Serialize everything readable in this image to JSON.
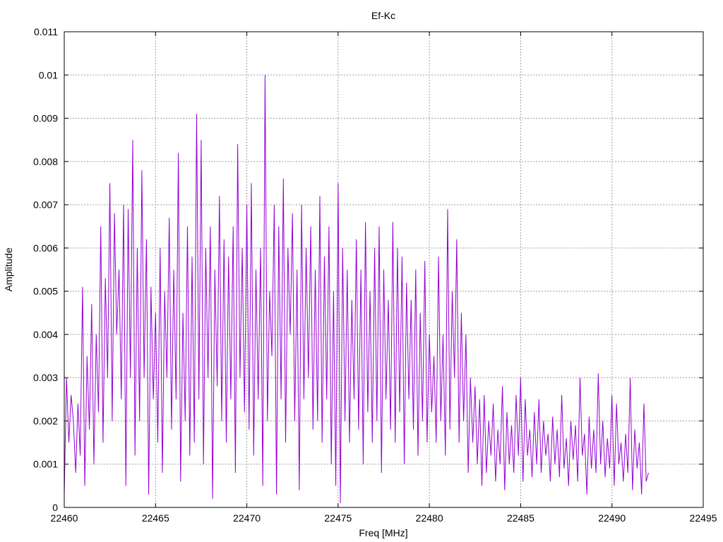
{
  "chart_data": {
    "type": "line",
    "title": "Ef-Kc",
    "xlabel": "Freq [MHz]",
    "ylabel": "Amplitude",
    "xlim": [
      22460,
      22495
    ],
    "ylim": [
      0,
      0.011
    ],
    "grid": true,
    "series_color": "#9400d3",
    "xticks": [
      "22460",
      "22465",
      "22470",
      "22475",
      "22480",
      "22485",
      "22490",
      "22495"
    ],
    "yticks": [
      "0",
      "0.001",
      "0.002",
      "0.003",
      "0.004",
      "0.005",
      "0.006",
      "0.007",
      "0.008",
      "0.009",
      "0.01",
      "0.011"
    ],
    "x_start": 22460,
    "x_step": 0.125,
    "values": [
      0.0003,
      0.003,
      0.0015,
      0.0026,
      0.002,
      0.0008,
      0.0024,
      0.0012,
      0.0051,
      0.0005,
      0.0035,
      0.0018,
      0.0047,
      0.001,
      0.004,
      0.0022,
      0.0065,
      0.0015,
      0.0053,
      0.003,
      0.0075,
      0.002,
      0.0068,
      0.004,
      0.0055,
      0.0025,
      0.007,
      0.0005,
      0.0069,
      0.003,
      0.0085,
      0.0012,
      0.006,
      0.002,
      0.0078,
      0.003,
      0.0062,
      0.0003,
      0.0051,
      0.0025,
      0.0045,
      0.0015,
      0.006,
      0.0008,
      0.005,
      0.003,
      0.0067,
      0.0018,
      0.0055,
      0.0025,
      0.0082,
      0.0006,
      0.0045,
      0.002,
      0.0065,
      0.0012,
      0.0058,
      0.0015,
      0.0091,
      0.0025,
      0.0085,
      0.001,
      0.006,
      0.003,
      0.0065,
      0.0002,
      0.0055,
      0.0028,
      0.0072,
      0.002,
      0.0062,
      0.0015,
      0.0058,
      0.0025,
      0.0065,
      0.0008,
      0.0084,
      0.003,
      0.006,
      0.0022,
      0.007,
      0.0018,
      0.0075,
      0.0012,
      0.0055,
      0.0025,
      0.006,
      0.0005,
      0.01,
      0.002,
      0.005,
      0.0035,
      0.007,
      0.0003,
      0.0065,
      0.0025,
      0.0076,
      0.0015,
      0.006,
      0.004,
      0.0068,
      0.002,
      0.0055,
      0.0004,
      0.007,
      0.0025,
      0.006,
      0.003,
      0.0065,
      0.0018,
      0.0055,
      0.002,
      0.0072,
      0.0015,
      0.0058,
      0.0025,
      0.0065,
      0.001,
      0.005,
      0.0005,
      0.0075,
      0.0001,
      0.006,
      0.002,
      0.0055,
      0.0015,
      0.0048,
      0.0025,
      0.0062,
      0.0018,
      0.0055,
      0.001,
      0.0066,
      0.0022,
      0.005,
      0.0015,
      0.006,
      0.002,
      0.0065,
      0.0008,
      0.0055,
      0.0025,
      0.0048,
      0.0018,
      0.0066,
      0.0015,
      0.006,
      0.0022,
      0.0058,
      0.001,
      0.0052,
      0.0025,
      0.0048,
      0.0018,
      0.0055,
      0.0012,
      0.0045,
      0.002,
      0.0057,
      0.0015,
      0.004,
      0.0022,
      0.0035,
      0.0015,
      0.0058,
      0.002,
      0.004,
      0.0012,
      0.0069,
      0.0018,
      0.005,
      0.003,
      0.0062,
      0.0015,
      0.0045,
      0.002,
      0.004,
      0.0008,
      0.003,
      0.0015,
      0.0028,
      0.001,
      0.0025,
      0.0005,
      0.0026,
      0.0008,
      0.002,
      0.0012,
      0.0024,
      0.0006,
      0.0018,
      0.001,
      0.0028,
      0.0004,
      0.0022,
      0.001,
      0.0019,
      0.0008,
      0.0026,
      0.0012,
      0.003,
      0.0006,
      0.0025,
      0.0012,
      0.0018,
      0.0007,
      0.0022,
      0.001,
      0.0025,
      0.0008,
      0.002,
      0.0012,
      0.0017,
      0.0006,
      0.0021,
      0.001,
      0.0018,
      0.0007,
      0.0026,
      0.0009,
      0.0016,
      0.0005,
      0.002,
      0.0011,
      0.0019,
      0.0006,
      0.003,
      0.0012,
      0.0017,
      0.0003,
      0.0021,
      0.0009,
      0.0018,
      0.0008,
      0.0031,
      0.001,
      0.002,
      0.0007,
      0.0016,
      0.0009,
      0.0026,
      0.0005,
      0.0024,
      0.001,
      0.0015,
      0.0006,
      0.0017,
      0.0008,
      0.003,
      0.0004,
      0.0018,
      0.0009,
      0.0015,
      0.0003,
      0.0024,
      0.0006,
      0.0008
    ]
  }
}
